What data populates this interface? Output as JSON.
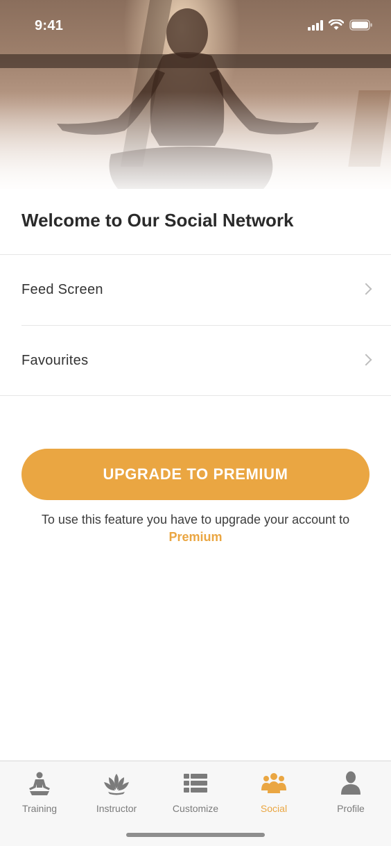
{
  "status_bar": {
    "time": "9:41",
    "signal_icon": "cellular-signal-icon",
    "wifi_icon": "wifi-icon",
    "battery_icon": "battery-icon"
  },
  "hero": {
    "image": "meditation-silhouette-photo"
  },
  "content": {
    "title": "Welcome to Our Social Network",
    "rows": [
      {
        "label": "Feed Screen",
        "icon": "chevron-right-icon"
      },
      {
        "label": "Favourites",
        "icon": "chevron-right-icon"
      }
    ],
    "upgrade_button": "UPGRADE TO PREMIUM",
    "hint_text": "To use this feature you have to upgrade your account to",
    "hint_accent": "Premium"
  },
  "tabs": [
    {
      "label": "Training",
      "icon": "meditation-icon",
      "active": false
    },
    {
      "label": "Instructor",
      "icon": "lotus-icon",
      "active": false
    },
    {
      "label": "Customize",
      "icon": "list-icon",
      "active": false
    },
    {
      "label": "Social",
      "icon": "group-icon",
      "active": true
    },
    {
      "label": "Profile",
      "icon": "user-icon",
      "active": false
    }
  ],
  "colors": {
    "accent": "#eaa642",
    "inactive_tab": "#7b7b7b",
    "text": "#2a2a2a"
  }
}
